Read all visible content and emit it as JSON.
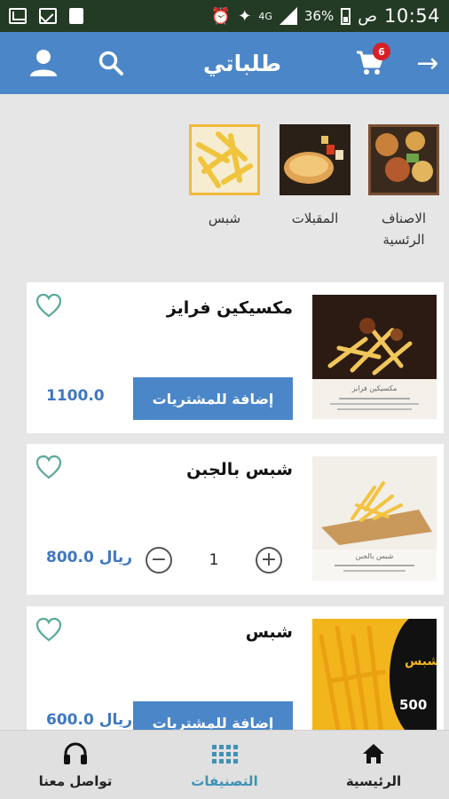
{
  "status_bar": {
    "time": "10:54",
    "am_pm": "ص",
    "battery": "36%",
    "network": "4G"
  },
  "header": {
    "title": "طلباتي",
    "cart_count": "6"
  },
  "categories": [
    {
      "label": "الاصناف\nالرئسية",
      "line1": "الاصناف",
      "line2": "الرئسية",
      "selected": false
    },
    {
      "label": "المقبلات",
      "selected": false
    },
    {
      "label": "شبس",
      "selected": true
    }
  ],
  "products": [
    {
      "name": "مكسيكين فرايز",
      "price": "1100.0",
      "add_label": "إضافة للمشتريات",
      "qty": null
    },
    {
      "name": "شبس بالجبن",
      "price": "800.0 ريال",
      "add_label": null,
      "qty": "1"
    },
    {
      "name": "شبس",
      "price": "600.0 ريال",
      "add_label": "إضافة للمشتريات",
      "qty": null
    }
  ],
  "product_image_captions": [
    "مكسيكين فرايز",
    "شبس بالجبن"
  ],
  "product3_image": {
    "name": "شبس",
    "price": "500"
  },
  "bottom_nav": [
    {
      "label": "الرئيسية",
      "icon": "home-icon"
    },
    {
      "label": "التصنيفات",
      "icon": "grid-icon",
      "active": true
    },
    {
      "label": "تواصل معنا",
      "icon": "headset-icon"
    }
  ],
  "colors": {
    "primary": "#4a86c8",
    "price": "#3f78c0",
    "accent_selected": "#f2b93b",
    "badge": "#d72027",
    "heart": "#5aa99a",
    "nav_active": "#3e92b5",
    "status_bar": "#233a24"
  }
}
